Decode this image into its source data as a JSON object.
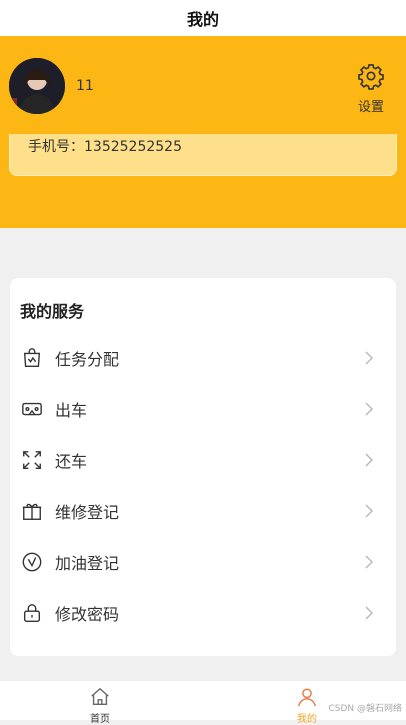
{
  "header": {
    "title": "我的"
  },
  "profile": {
    "username": "11",
    "phone_label": "手机号：",
    "phone": "13525252525"
  },
  "settings": {
    "label": "设置"
  },
  "services": {
    "title": "我的服务",
    "items": [
      {
        "label": "任务分配",
        "icon": "task-bag-icon"
      },
      {
        "label": "出车",
        "icon": "vr-car-icon"
      },
      {
        "label": "还车",
        "icon": "expand-arrows-icon"
      },
      {
        "label": "维修登记",
        "icon": "gift-box-icon"
      },
      {
        "label": "加油登记",
        "icon": "gauge-icon"
      },
      {
        "label": "修改密码",
        "icon": "lock-icon"
      }
    ]
  },
  "tabs": [
    {
      "label": "首页",
      "icon": "home-icon",
      "active": false
    },
    {
      "label": "我的",
      "icon": "user-icon",
      "active": true
    }
  ],
  "watermark": "CSDN @磐石网络",
  "colors": {
    "brand": "#fdb714",
    "active_tab": "#f5a623"
  }
}
